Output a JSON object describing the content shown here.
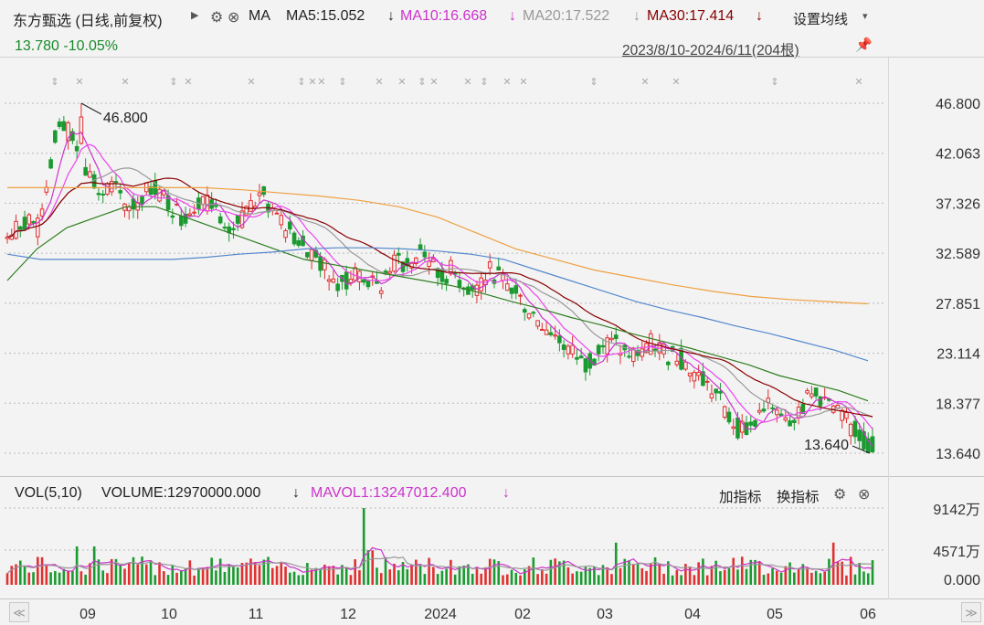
{
  "header": {
    "title": "东方甄选 (日线,前复权)",
    "ma_label": "MA",
    "ma5": "MA5:15.052",
    "ma10": "MA10:16.668",
    "ma20": "MA20:17.522",
    "ma30": "MA30:17.414",
    "down_arrow": "↓",
    "settings_label": "设置均线",
    "price_change": "13.780 -10.05%",
    "date_range": "2023/8/10-2024/6/11(204根)",
    "colors": {
      "ma5": "#cc33cc",
      "ma10": "#ee44ee",
      "ma20": "#999999",
      "ma30": "#880000",
      "price_change": "#1a8a2a"
    }
  },
  "volume_panel": {
    "vol_label": "VOL(5,10)",
    "volume_label": "VOLUME:12970000.000",
    "mavol_label": "MAVOL1:13247012.400",
    "down_arrow": "↓",
    "add_indicator": "加指标",
    "switch_indicator": "换指标"
  },
  "chart_data": {
    "type": "candlestick",
    "price_ticks": [
      "46.800",
      "42.063",
      "37.326",
      "32.589",
      "27.851",
      "23.114",
      "18.377",
      "13.640"
    ],
    "price_ylim": [
      13.64,
      46.8
    ],
    "annotations": {
      "high": "46.800",
      "low": "13.640"
    },
    "volume_ticks": [
      "9142万",
      "4571万",
      "0.000"
    ],
    "x_labels": [
      "09",
      "10",
      "11",
      "12",
      "2024",
      "02",
      "03",
      "04",
      "05",
      "06"
    ],
    "close_path": [
      34,
      35,
      36,
      35,
      40,
      45,
      44,
      42,
      40,
      38,
      39,
      38,
      37,
      38,
      39,
      38,
      37,
      36,
      37,
      38,
      37,
      36,
      35,
      36,
      37,
      38,
      36,
      35,
      34,
      33,
      32,
      31,
      30,
      30,
      31,
      30,
      29,
      31,
      32,
      31,
      33,
      32,
      30,
      31,
      30,
      29,
      30,
      31,
      30,
      29,
      28,
      27,
      26,
      25,
      24,
      23,
      22,
      23,
      24,
      24,
      23,
      23,
      24,
      24,
      23,
      23,
      22,
      21,
      20,
      19,
      17,
      16,
      16,
      17,
      18,
      18,
      17,
      18,
      19,
      19,
      18,
      17,
      16,
      15,
      14
    ],
    "ma_lines": [
      {
        "name": "MA5",
        "color": "#cc33cc",
        "values": []
      },
      {
        "name": "MA10",
        "color": "#ee44ee",
        "values": []
      },
      {
        "name": "MA20",
        "color": "#999999",
        "values": []
      },
      {
        "name": "MA30",
        "color": "#880000",
        "values": []
      },
      {
        "name": "",
        "color": "#2e7d1f",
        "values": [
          30,
          33,
          35,
          36,
          37,
          37,
          36,
          35,
          34,
          33,
          32,
          31.5,
          31,
          30.5,
          30,
          29.5,
          28.8,
          28,
          27.3,
          26.5,
          25.8,
          25,
          24.3,
          23.6,
          22.8,
          22,
          21,
          20.3,
          19.6,
          18.6
        ]
      },
      {
        "name": "",
        "color": "#5588cc",
        "values": [
          32.5,
          32,
          32,
          32,
          32,
          32,
          32.2,
          32.5,
          32.7,
          33,
          33.1,
          33.1,
          33,
          32.8,
          32.5,
          32,
          31,
          30,
          29,
          28,
          27.2,
          26.5,
          25.7,
          25,
          24.2,
          23.4,
          22.4
        ]
      },
      {
        "name": "",
        "color": "#eea040",
        "values": [
          38.8,
          38.8,
          38.8,
          38.8,
          38.8,
          38.8,
          38.6,
          38.3,
          38,
          37.6,
          37,
          36,
          34.5,
          33,
          32,
          31,
          30.3,
          29.6,
          29,
          28.5,
          28.2,
          28,
          27.8
        ]
      }
    ]
  }
}
